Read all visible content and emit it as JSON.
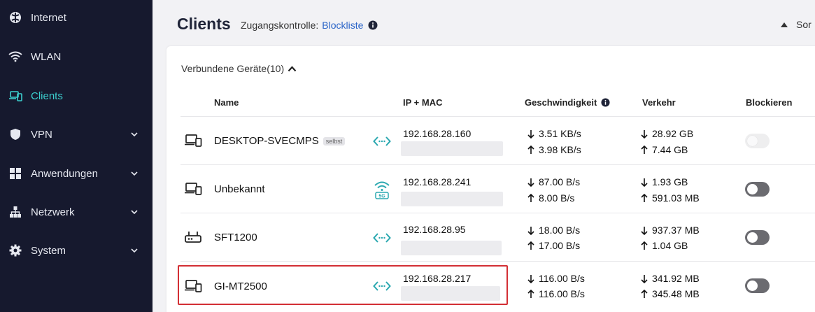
{
  "sidebar": {
    "items": [
      {
        "label": "Internet",
        "icon": "globe-icon"
      },
      {
        "label": "WLAN",
        "icon": "wifi-icon"
      },
      {
        "label": "Clients",
        "icon": "devices-icon",
        "active": true
      },
      {
        "label": "VPN",
        "icon": "shield-icon",
        "expandable": true
      },
      {
        "label": "Anwendungen",
        "icon": "grid-icon",
        "expandable": true
      },
      {
        "label": "Netzwerk",
        "icon": "network-icon",
        "expandable": true
      },
      {
        "label": "System",
        "icon": "gear-icon",
        "expandable": true
      }
    ]
  },
  "header": {
    "title": "Clients",
    "access_label": "Zugangskontrolle:",
    "access_link": "Blockliste",
    "sort_label": "Sor"
  },
  "group": {
    "label": "Verbundene Geräte(10)"
  },
  "table": {
    "columns": {
      "name": "Name",
      "ipmac": "IP + MAC",
      "speed": "Geschwindigkeit",
      "traffic": "Verkehr",
      "block": "Blockieren"
    },
    "rows": [
      {
        "name": "DESKTOP-SVECMPS",
        "badge": "selbst",
        "device_icon": "laptop-phone-icon",
        "connection": "ethernet-icon",
        "ip": "192.168.28.160",
        "down_speed": "3.51 KB/s",
        "up_speed": "3.98 KB/s",
        "down_traffic": "28.92 GB",
        "up_traffic": "7.44 GB",
        "blocked": false,
        "toggle_disabled": true
      },
      {
        "name": "Unbekannt",
        "device_icon": "laptop-phone-icon",
        "connection": "wifi-5g-icon",
        "ip": "192.168.28.241",
        "down_speed": "87.00 B/s",
        "up_speed": "8.00 B/s",
        "down_traffic": "1.93 GB",
        "up_traffic": "591.03 MB",
        "blocked": false
      },
      {
        "name": "SFT1200",
        "device_icon": "router-icon",
        "connection": "ethernet-icon",
        "ip": "192.168.28.95",
        "down_speed": "18.00 B/s",
        "up_speed": "17.00 B/s",
        "down_traffic": "937.37 MB",
        "up_traffic": "1.04 GB",
        "blocked": false
      },
      {
        "name": "GI-MT2500",
        "device_icon": "laptop-phone-icon",
        "connection": "ethernet-icon",
        "ip": "192.168.28.217",
        "down_speed": "116.00 B/s",
        "up_speed": "116.00 B/s",
        "down_traffic": "341.92 MB",
        "up_traffic": "345.48 MB",
        "blocked": false
      }
    ]
  },
  "colors": {
    "sidebar_bg": "#16192e",
    "accent": "#3ccfcf",
    "link": "#2a64c8",
    "highlight": "#d32f34"
  }
}
